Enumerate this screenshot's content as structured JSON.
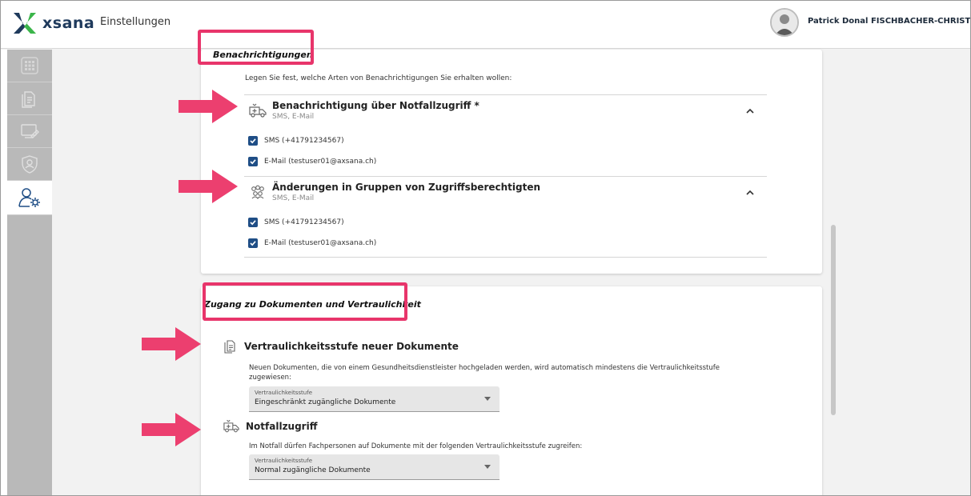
{
  "header": {
    "logo_text": "xsana",
    "app_title": "Einstellungen",
    "user_name": "Patrick Donal FISCHBACHER-CHRISTEN"
  },
  "sidebar": {
    "items": [
      {
        "icon": "apps-grid-icon"
      },
      {
        "icon": "documents-icon"
      },
      {
        "icon": "edit-screen-icon"
      },
      {
        "icon": "shield-user-icon"
      },
      {
        "icon": "user-settings-icon",
        "active": true
      }
    ]
  },
  "notifications": {
    "title": "Benachrichtigungen",
    "intro": "Legen Sie fest, welche Arten von Benachrichtigungen Sie erhalten wollen:",
    "groups": [
      {
        "icon": "ambulance-icon",
        "title": "Benachrichtigung über Notfallzugriff *",
        "subtitle": "SMS, E-Mail",
        "options": [
          {
            "label": "SMS (+41791234567)",
            "checked": true
          },
          {
            "label": "E-Mail (testuser01@axsana.ch)",
            "checked": true
          }
        ]
      },
      {
        "icon": "group-icon",
        "title": "Änderungen in Gruppen von Zugriffsberechtigten",
        "subtitle": "SMS, E-Mail",
        "options": [
          {
            "label": "SMS (+41791234567)",
            "checked": true
          },
          {
            "label": "E-Mail (testuser01@axsana.ch)",
            "checked": true
          }
        ]
      }
    ]
  },
  "access": {
    "title": "Zugang zu Dokumenten und Vertraulichkeit",
    "confidentiality": {
      "icon": "documents-icon",
      "title": "Vertraulichkeitsstufe neuer Dokumente",
      "desc_line1": "Neuen Dokumenten, die von einem Gesundheitsdienstleister hochgeladen werden, wird automatisch mindestens die Vertraulichkeitsstufe",
      "desc_line2": "zugewiesen:",
      "select_label": "Vertraulichkeitsstufe",
      "select_value": "Eingeschränkt zugängliche Dokumente"
    },
    "emergency": {
      "icon": "ambulance-icon",
      "title": "Notfallzugriff",
      "desc": "Im Notfall dürfen Fachpersonen auf Dokumente mit der folgenden Vertraulichkeitsstufe zugreifen:",
      "select_label": "Vertraulichkeitsstufe",
      "select_value": "Normal zugängliche Dokumente"
    }
  },
  "colors": {
    "highlight": "#e8356b",
    "arrow": "#ec3f6f",
    "checkbox": "#1f4e86",
    "sidebar": "#b9b9b9"
  }
}
